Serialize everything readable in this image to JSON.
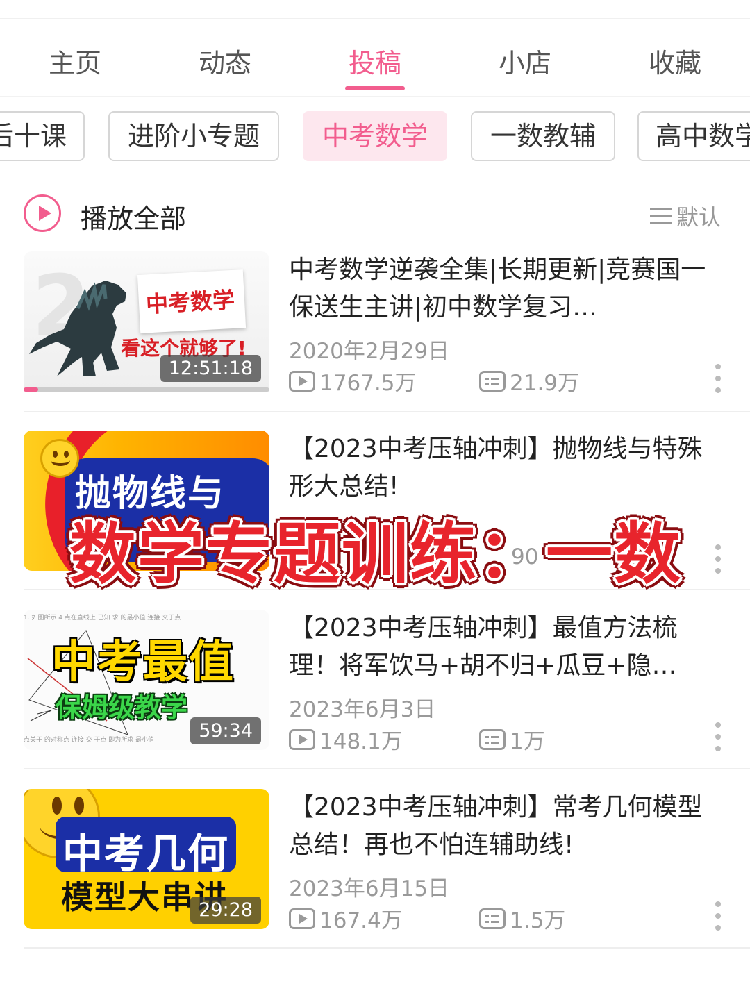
{
  "tabs": [
    {
      "label": "主页"
    },
    {
      "label": "动态"
    },
    {
      "label": "投稿",
      "active": true
    },
    {
      "label": "小店"
    },
    {
      "label": "收藏"
    }
  ],
  "chips": [
    {
      "label": "后十课"
    },
    {
      "label": "进阶小专题"
    },
    {
      "label": "中考数学",
      "active": true
    },
    {
      "label": "一数教辅"
    },
    {
      "label": "高中数学"
    }
  ],
  "play_all": {
    "label": "播放全部",
    "icon": "play-circle-icon"
  },
  "sort": {
    "label": "默认",
    "icon": "list-sort-icon"
  },
  "accent_color": "#f25d8e",
  "videos": [
    {
      "title": "中考数学逆袭全集|长期更新|竞赛国一保送生主讲|初中数学复习…",
      "date": "2020年2月29日",
      "views": "1767.5万",
      "danmaku": "21.9万",
      "duration": "12:51:18",
      "watch_progress": 0.06,
      "thumb_text": [
        "中考数学",
        "看这个就够了!"
      ]
    },
    {
      "title": "【2023中考压轴冲刺】抛物线与特殊形大总结!",
      "date": "",
      "views": "90",
      "danmaku": "",
      "duration": "",
      "thumb_text": [
        "抛物线与"
      ]
    },
    {
      "title": "【2023中考压轴冲刺】最值方法梳理！将军饮马+胡不归+瓜豆+隐…",
      "date": "2023年6月3日",
      "views": "148.1万",
      "danmaku": "1万",
      "duration": "59:34",
      "thumb_text": [
        "中考最值",
        "保姆级教学"
      ]
    },
    {
      "title": "【2023中考压轴冲刺】常考几何模型总结！再也不怕连辅助线!",
      "date": "2023年6月15日",
      "views": "167.4万",
      "danmaku": "1.5万",
      "duration": "29:28",
      "thumb_text": [
        "中考几何",
        "模型大串讲"
      ]
    }
  ],
  "overlay_banner": "数学专题训练：一数"
}
